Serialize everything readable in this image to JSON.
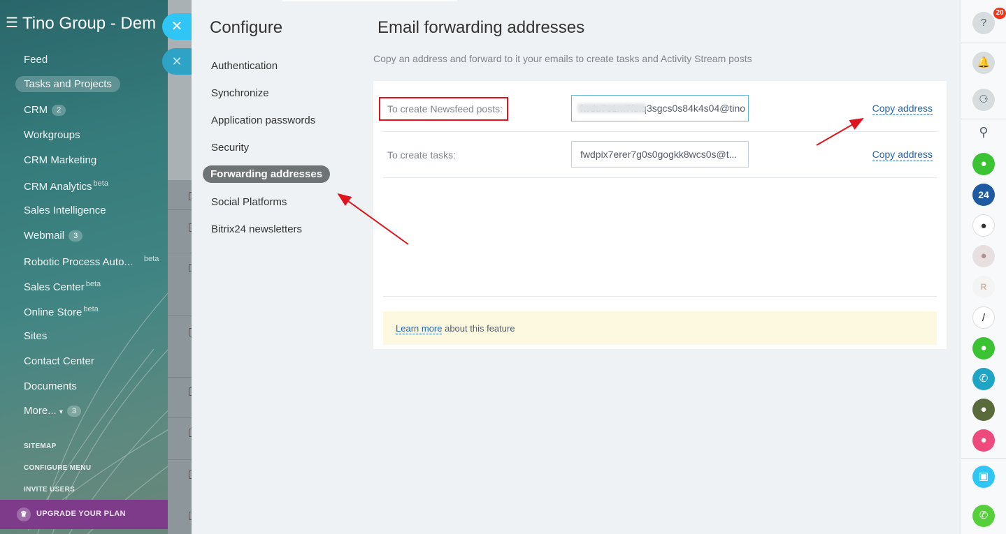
{
  "portal": {
    "title": "Tino Group - Dem",
    "menu": [
      {
        "label": "Feed"
      },
      {
        "label": "Tasks and Projects",
        "active": true
      },
      {
        "label": "CRM",
        "count": "2"
      },
      {
        "label": "Workgroups"
      },
      {
        "label": "CRM Marketing"
      },
      {
        "label": "CRM Analytics",
        "beta": "beta"
      },
      {
        "label": "Sales Intelligence"
      },
      {
        "label": "Webmail",
        "count": "3"
      },
      {
        "label": "Robotic Process Auto...",
        "beta": "beta"
      },
      {
        "label": "Sales Center",
        "beta": "beta"
      },
      {
        "label": "Online Store",
        "beta": "beta"
      },
      {
        "label": "Sites"
      },
      {
        "label": "Contact Center"
      },
      {
        "label": "Documents"
      },
      {
        "label": "More...",
        "count": "3"
      }
    ],
    "sitemap": "SITEMAP",
    "configure_menu": "CONFIGURE MENU",
    "invite_users": "INVITE USERS",
    "upgrade": "UPGRADE YOUR PLAN"
  },
  "configure": {
    "title": "Configure",
    "items": [
      {
        "label": "Authentication"
      },
      {
        "label": "Synchronize"
      },
      {
        "label": "Application passwords"
      },
      {
        "label": "Security"
      },
      {
        "label": "Forwarding addresses",
        "active": true
      },
      {
        "label": "Social Platforms"
      },
      {
        "label": "Bitrix24 newsletters"
      }
    ]
  },
  "forwarding": {
    "title": "Email forwarding addresses",
    "description": "Copy an address and forward to it your emails to create tasks and Activity Stream posts",
    "rows": [
      {
        "label": "To create Newsfeed posts:",
        "value": "fwdu7e1rx7ftxq3sgcs0s84k4s04@tino",
        "copy": "Copy address"
      },
      {
        "label": "To create tasks:",
        "value": "fwdpix7erer7g0s0gogkk8wcs0s@t...",
        "copy": "Copy address"
      }
    ],
    "notice": {
      "link": "Learn more",
      "text": " about this feature"
    }
  },
  "right_bar": {
    "help_badge": "20",
    "icons": [
      "help-icon",
      "bell-icon",
      "chat-icon",
      "search-icon",
      "user-avatar",
      "bitrix24-logo",
      "user-avatar",
      "user-avatar",
      "user-avatar",
      "user-avatar",
      "user-avatar",
      "phone-icon",
      "user-avatar",
      "user-avatar",
      "app-icon",
      "call-icon"
    ],
    "logo_24": "24"
  },
  "colors": {
    "accent": "#2fc6f6",
    "link": "#2067b0",
    "highlight": "#e0141c",
    "active_nav": "#6e7375",
    "upgrade": "#7e3b8a"
  }
}
